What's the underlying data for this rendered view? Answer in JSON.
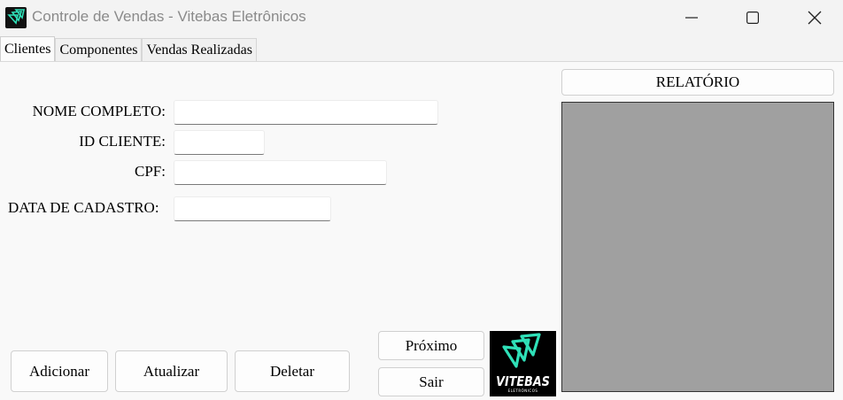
{
  "window": {
    "title": "Controle de Vendas - Vitebas Eletrônicos",
    "icons": [
      "app-logo-icon",
      "minimize-icon",
      "maximize-icon",
      "close-icon"
    ]
  },
  "tabs": [
    {
      "label": "Clientes",
      "active": true
    },
    {
      "label": "Componentes",
      "active": false
    },
    {
      "label": "Vendas Realizadas",
      "active": false
    }
  ],
  "form": {
    "nome_label": "NOME COMPLETO:",
    "nome_value": "",
    "id_label": "ID CLIENTE:",
    "id_value": "",
    "cpf_label": "CPF:",
    "cpf_value": "",
    "data_label": "DATA DE CADASTRO:",
    "data_value": ""
  },
  "buttons": {
    "relatorio": "RELATÓRIO",
    "adicionar": "Adicionar",
    "atualizar": "Atualizar",
    "deletar": "Deletar",
    "proximo": "Próximo",
    "sair": "Sair"
  },
  "logo": {
    "name": "VITEBAS",
    "subtitle": "ELETRÔNICOS"
  },
  "colors": {
    "accent": "#2fe0b8",
    "report_area": "#a0a0a0"
  }
}
